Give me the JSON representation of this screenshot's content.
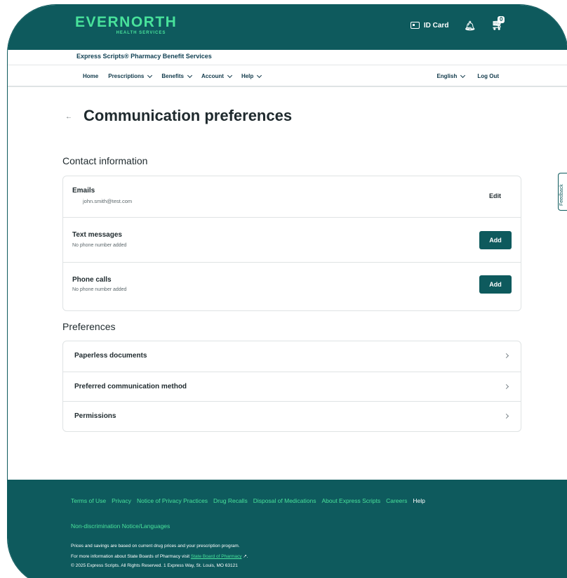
{
  "header": {
    "logo_main": "EVERNORTH",
    "logo_sub": "HEALTH SERVICES",
    "id_card_label": "ID Card",
    "cart_count": "0",
    "subbrand": "Express Scripts® Pharmacy Benefit Services"
  },
  "nav": {
    "left": [
      "Home",
      "Prescriptions",
      "Benefits",
      "Account",
      "Help"
    ],
    "language": "English",
    "logout": "Log Out"
  },
  "page": {
    "back_glyph": "←",
    "title": "Communication preferences"
  },
  "contact": {
    "section_title": "Contact information",
    "emails": {
      "title": "Emails",
      "value": "john.smith@test.com",
      "action": "Edit"
    },
    "text_messages": {
      "title": "Text messages",
      "value": "No phone number added",
      "action": "Add"
    },
    "phone_calls": {
      "title": "Phone calls",
      "value": "No phone number added",
      "action": "Add"
    }
  },
  "preferences": {
    "section_title": "Preferences",
    "items": [
      "Paperless documents",
      "Preferred communication method",
      "Permissions"
    ]
  },
  "feedback_label": "Feedback",
  "footer": {
    "links": [
      "Terms of Use",
      "Privacy",
      "Notice of Privacy Practices",
      "Drug Recalls",
      "Disposal of Medications",
      "About Express Scripts",
      "Careers",
      "Help"
    ],
    "nondiscrimination": "Non-discrimination Notice/Languages",
    "prices_note": "Prices and savings are based on current drug prices and your prescription program.",
    "boards_prefix": "For more information about State Boards of Pharmacy visit",
    "boards_link": "State Board of Pharmacy",
    "copyright": "© 2025 Express Scripts. All Rights Reserved. 1 Express Way, St. Louis, MO 63121"
  },
  "colors": {
    "brand_teal": "#0e5a5d",
    "accent_green": "#48e29b"
  }
}
